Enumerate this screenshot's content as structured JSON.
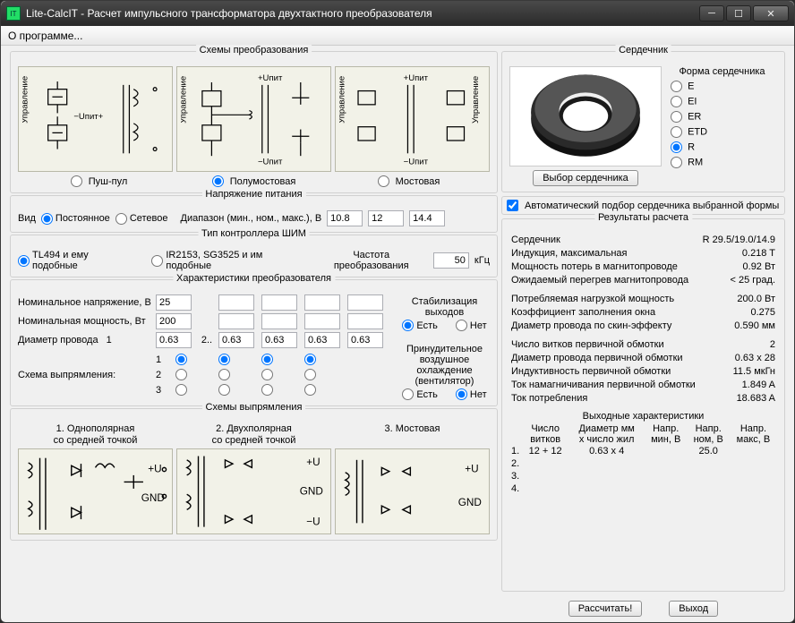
{
  "window": {
    "title": "Lite-CalcIT - Расчет импульсного трансформатора двухтактного преобразователя",
    "menu_about": "О программе..."
  },
  "schemes": {
    "legend": "Схемы  преобразования",
    "upit_plus": "+Uпит",
    "upit_minus": "−Uпит",
    "upit_pm": "−Uпит+",
    "control": "Управление",
    "radio_pushpull": "Пуш-пул",
    "radio_halfbridge": "Полумостовая",
    "radio_bridge": "Мостовая",
    "selected": "halfbridge"
  },
  "supply": {
    "legend": "Напряжение питания",
    "kind_label": "Вид",
    "dc": "Постоянное",
    "ac": "Сетевое",
    "range_label": "Диапазон (мин., ном., макс.), В",
    "min": "10.8",
    "nom": "12",
    "max": "14.4"
  },
  "pwm": {
    "legend": "Тип контроллера ШИМ",
    "opt1": "TL494 и ему подобные",
    "opt2": "IR2153, SG3525 и им подобные",
    "freq_label": "Частота преобразования",
    "freq": "50",
    "freq_unit": "кГц"
  },
  "conv": {
    "legend": "Характеристики преобразователя",
    "nom_v_label": "Номинальное напряжение, В",
    "nom_v": "25",
    "nom_p_label": "Номинальная мощность, Вт",
    "nom_p": "200",
    "wire_d_label": "Диаметр провода",
    "wire_p": "0.63",
    "twodots": "2..",
    "d2": "0.63",
    "d3": "0.63",
    "d4": "0.63",
    "d5": "0.63",
    "rect_label": "Схема выпрямления:",
    "stab_label": "Стабилизация выходов",
    "yes": "Есть",
    "no": "Нет",
    "forced_label1": "Принудительное воздушное",
    "forced_label2": "охлаждение (вентилятор)",
    "col1": "1",
    "r1": "1",
    "r2": "2",
    "r3": "3"
  },
  "rect": {
    "legend": "Схемы выпрямления",
    "t1a": "1. Однополярная",
    "t1b": "со средней точкой",
    "t2a": "2. Двухполярная",
    "t2b": "со средней точкой",
    "t3a": "3. Мостовая",
    "t3b": "",
    "u": "+U",
    "mu": "−U",
    "gnd": "GND"
  },
  "core": {
    "legend": "Сердечник",
    "shape_title": "Форма сердечника",
    "E": "E",
    "EI": "EI",
    "ER": "ER",
    "ETD": "ETD",
    "R": "R",
    "RM": "RM",
    "select_btn": "Выбор сердечника",
    "auto_label": "Автоматический подбор сердечника выбранной формы"
  },
  "results": {
    "legend": "Результаты расчета",
    "core_label": "Сердечник",
    "core_val": "R 29.5/19.0/14.9",
    "bmax_label": "Индукция, максимальная",
    "bmax": "0.218 T",
    "ploss_label": "Мощность потерь в магнитопроводе",
    "ploss": "0.92 Вт",
    "trise_label": "Ожидаемый перегрев магнитопровода",
    "trise": "< 25 град.",
    "pload_label": "Потребляемая нагрузкой мощность",
    "pload": "200.0 Вт",
    "kfill_label": "Коэффициент заполнения окна",
    "kfill": "0.275",
    "dskin_label": "Диаметр провода по скин-эффекту",
    "dskin": "0.590 мм",
    "nprim_label": "Число витков первичной обмотки",
    "nprim": "2",
    "dprim_label": "Диаметр провода первичной обмотки",
    "dprim": "0.63 x 28",
    "lprim_label": "Индуктивность первичной обмотки",
    "lprim": "11.5 мкГн",
    "imag_label": "Ток намагничивания первичной обмотки",
    "imag": "1.849 A",
    "icons_label": "Ток потребления",
    "icons": "18.683 A",
    "out_title": "Выходные характеристики",
    "h_turns_a": "Число",
    "h_turns_b": "витков",
    "h_diam_a": "Диаметр мм",
    "h_diam_b": "x число жил",
    "h_vmin_a": "Напр.",
    "h_vmin_b": "мин, В",
    "h_vnom_a": "Напр.",
    "h_vnom_b": "ном, В",
    "h_vmax_a": "Напр.",
    "h_vmax_b": "макс, В",
    "rows": [
      {
        "idx": "1.",
        "turns": "12 + 12",
        "d": "0.63 x 4",
        "vmin": "",
        "vnom": "25.0",
        "vmax": ""
      },
      {
        "idx": "2.",
        "turns": "",
        "d": "",
        "vmin": "",
        "vnom": "",
        "vmax": ""
      },
      {
        "idx": "3.",
        "turns": "",
        "d": "",
        "vmin": "",
        "vnom": "",
        "vmax": ""
      },
      {
        "idx": "4.",
        "turns": "",
        "d": "",
        "vmin": "",
        "vnom": "",
        "vmax": ""
      }
    ]
  },
  "buttons": {
    "calc": "Рассчитать!",
    "exit": "Выход"
  }
}
